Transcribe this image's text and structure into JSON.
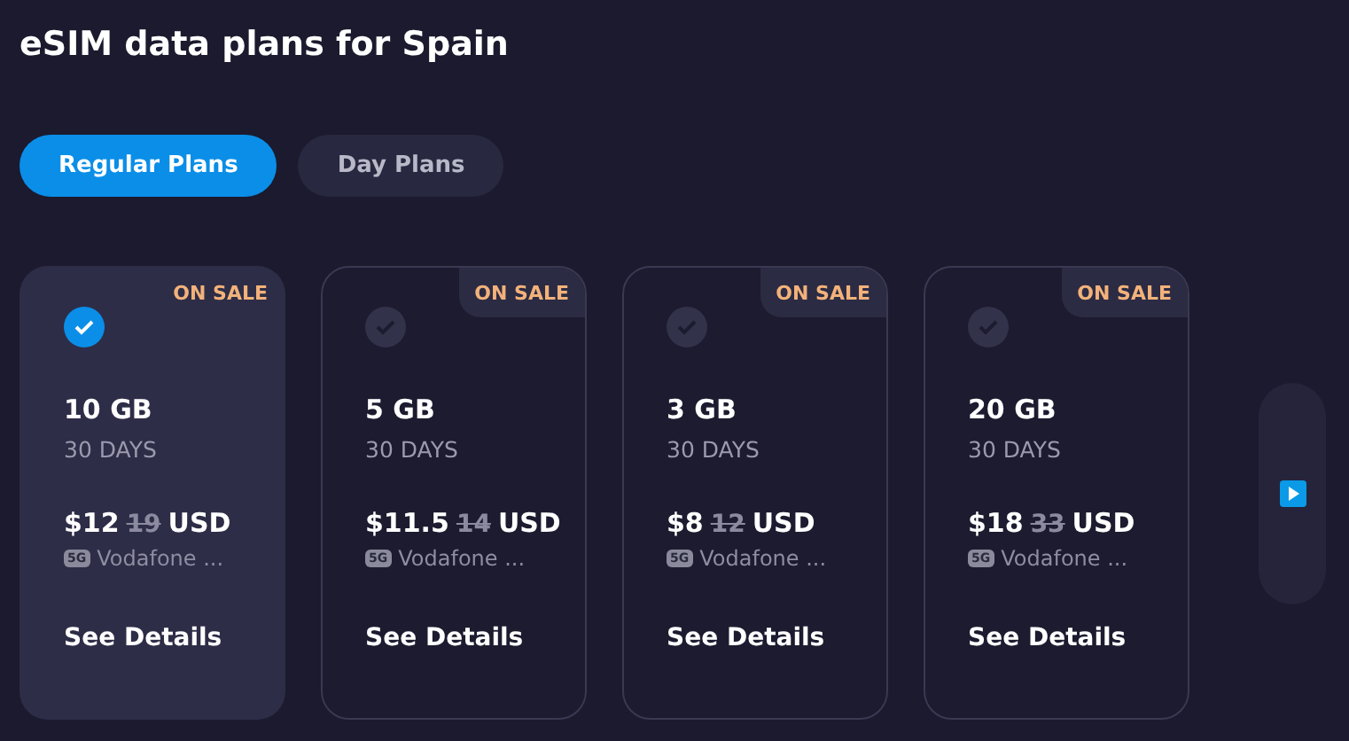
{
  "title": "eSIM data plans for Spain",
  "tabs": [
    {
      "label": "Regular Plans",
      "selected": true
    },
    {
      "label": "Day Plans",
      "selected": false
    }
  ],
  "plans": [
    {
      "badge": "ON SALE",
      "selected": true,
      "data": "10 GB",
      "duration": "30 DAYS",
      "price": "$12",
      "old_price": "19",
      "currency": "USD",
      "network_type": "5G",
      "network": "Vodafone ...",
      "details": "See Details"
    },
    {
      "badge": "ON SALE",
      "selected": false,
      "data": "5 GB",
      "duration": "30 DAYS",
      "price": "$11.5",
      "old_price": "14",
      "currency": "USD",
      "network_type": "5G",
      "network": "Vodafone ...",
      "details": "See Details"
    },
    {
      "badge": "ON SALE",
      "selected": false,
      "data": "3 GB",
      "duration": "30 DAYS",
      "price": "$8",
      "old_price": "12",
      "currency": "USD",
      "network_type": "5G",
      "network": "Vodafone ...",
      "details": "See Details"
    },
    {
      "badge": "ON SALE",
      "selected": false,
      "data": "20 GB",
      "duration": "30 DAYS",
      "price": "$18",
      "old_price": "33",
      "currency": "USD",
      "network_type": "5G",
      "network": "Vodafone ...",
      "details": "See Details"
    }
  ]
}
